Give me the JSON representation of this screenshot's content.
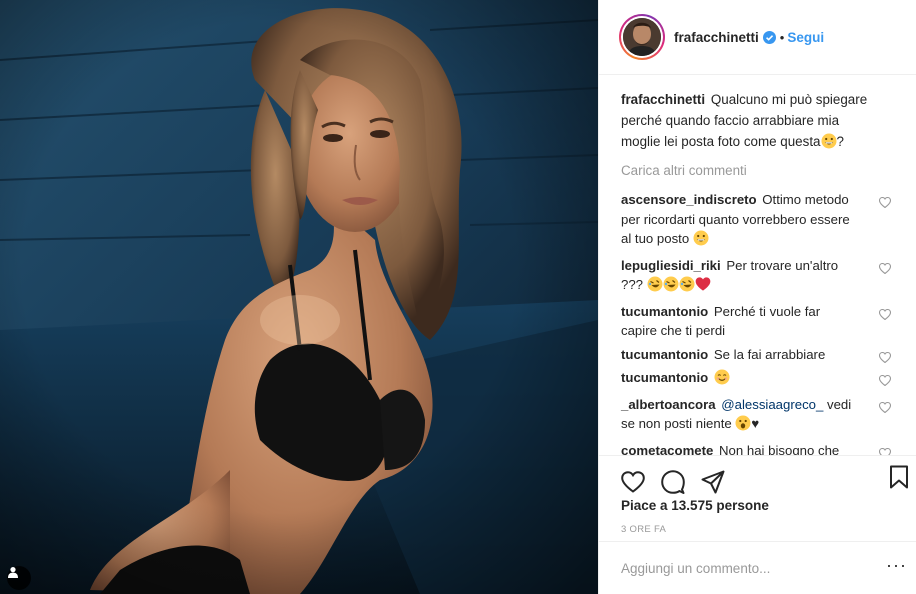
{
  "post": {
    "username": "frafacchinetti",
    "follow_label": "Segui",
    "dot": "•",
    "caption_text": "Qualcuno mi può spiegare perché quando faccio arrabbiare mia moglie lei posta foto come questa",
    "caption_tail": "?",
    "load_more": "Carica altri commenti",
    "likes": "Piace a 13.575 persone",
    "time": "3 ORE FA",
    "add_comment_placeholder": "Aggiungi un commento...",
    "more_options": "···"
  },
  "comments": [
    {
      "user": "ascensore_indiscreto",
      "text": "Ottimo metodo per ricordarti quanto vorrebbero essere al tuo posto",
      "emoji": [
        "grin"
      ]
    },
    {
      "user": "lepugliesidi_riki",
      "text": "Per trovare un'altro ???",
      "emoji": [
        "rofl",
        "rofl",
        "rofl",
        "red-heart"
      ]
    },
    {
      "user": "tucumantonio",
      "text": "Perché ti vuole far capire che ti perdi",
      "emoji": []
    },
    {
      "user": "tucumantonio",
      "text": "Se la fai arrabbiare",
      "emoji": []
    },
    {
      "user": "tucumantonio",
      "text": "",
      "emoji": [
        "smile"
      ]
    },
    {
      "user": "_albertoancora",
      "mention": "@alessiaagreco_",
      "text": "vedi se non posti niente",
      "emoji": [
        "open-mouth"
      ],
      "suffix": "♥"
    },
    {
      "user": "cometacomete",
      "text": "Non hai bisogno che qualcuno ti dica che con le donne non ci cambetti , anche perché è",
      "emoji": []
    }
  ],
  "icons": {
    "verified": "verified-badge-icon",
    "heart": "heart-outline-icon",
    "comment": "comment-bubble-icon",
    "share": "share-paper-plane-icon",
    "save": "bookmark-icon",
    "tag": "user-tag-icon"
  },
  "colors": {
    "link": "#3897f0",
    "muted": "#999999",
    "border": "#efefef",
    "text": "#262626"
  }
}
